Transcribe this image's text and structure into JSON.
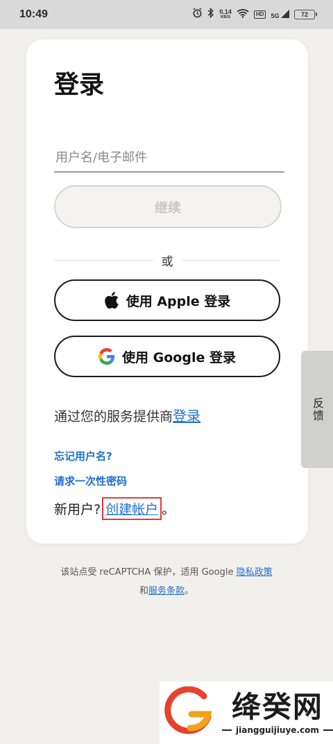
{
  "status_bar": {
    "time": "10:49",
    "net_speed_value": "0.14",
    "net_speed_unit": "KB/S",
    "hd_label": "HD",
    "signal_label": "5G",
    "battery": "72"
  },
  "login": {
    "title": "登录",
    "username_placeholder": "用户名/电子邮件",
    "continue_label": "继续",
    "or_label": "或",
    "apple_label": "使用 Apple 登录",
    "google_label": "使用 Google 登录",
    "provider_prefix": "通过您的服务提供商",
    "provider_link": "登录",
    "forgot_username": "忘记用户名?",
    "request_otp": "请求一次性密码",
    "new_user_prefix": "新用户?",
    "create_account": "创建帐户",
    "new_user_suffix": "。"
  },
  "feedback": {
    "label": "反馈"
  },
  "recaptcha": {
    "line1_prefix": "该站点受 reCAPTCHA 保护，适用 Google ",
    "privacy_link": "隐私政策",
    "and": "和",
    "terms_link": "服务条款",
    "period": "。"
  },
  "watermark": {
    "title": "绛癸网",
    "url": "jiangguijiuye.com"
  },
  "colors": {
    "link": "#1f6fd1",
    "highlight_box": "#e53935",
    "page_bg": "#f2f0ec"
  }
}
